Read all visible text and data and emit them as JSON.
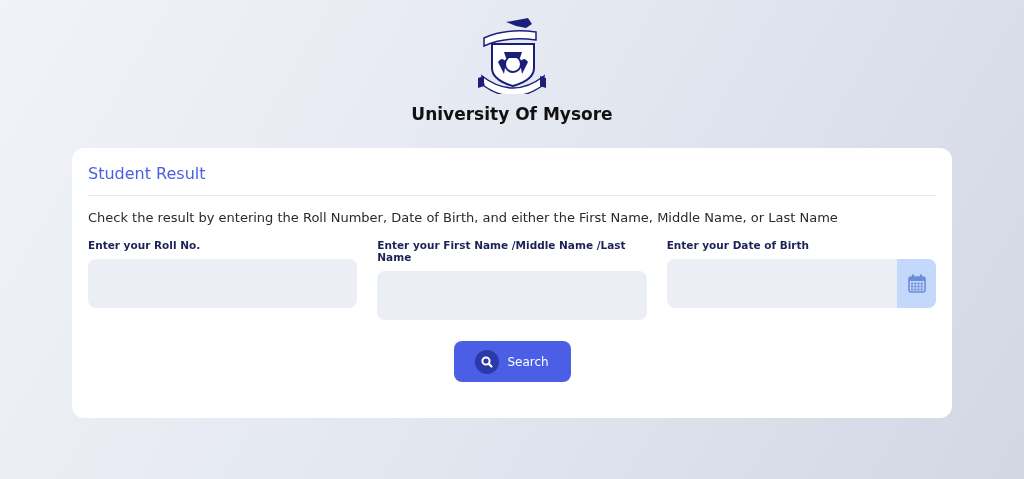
{
  "header": {
    "title": "University Of Mysore"
  },
  "card": {
    "title": "Student Result",
    "description": "Check the result by entering the Roll Number, Date of Birth, and either the First Name, Middle Name, or Last Name",
    "fields": [
      {
        "label": "Enter your Roll No.",
        "kind": "text"
      },
      {
        "label": "Enter your First Name /Middle Name /Last Name",
        "kind": "text"
      },
      {
        "label": "Enter your Date of Birth",
        "kind": "date"
      }
    ],
    "button": {
      "label": "Search"
    }
  }
}
